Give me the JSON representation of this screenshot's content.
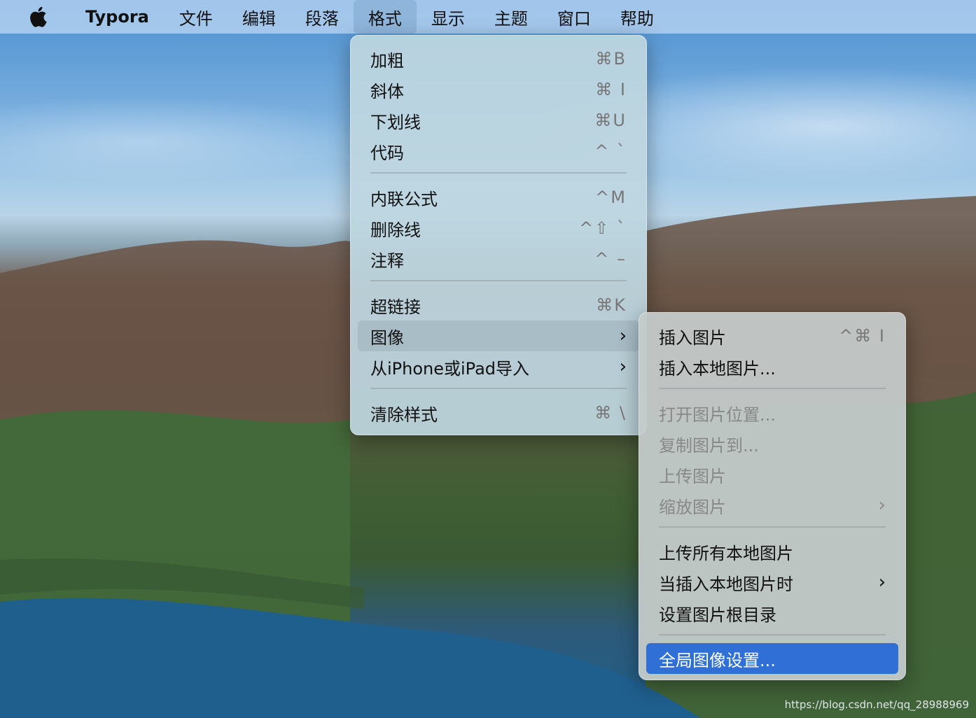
{
  "menubar": {
    "apple_icon": "apple-logo",
    "app_name": "Typora",
    "items": [
      "文件",
      "编辑",
      "段落",
      "格式",
      "显示",
      "主题",
      "窗口",
      "帮助"
    ],
    "active": "格式"
  },
  "format_menu": {
    "items": [
      {
        "label": "加粗",
        "shortcut": "⌘B"
      },
      {
        "label": "斜体",
        "shortcut": "⌘ I"
      },
      {
        "label": "下划线",
        "shortcut": "⌘U"
      },
      {
        "label": "代码",
        "shortcut": "^ `"
      },
      {
        "label": "内联公式",
        "shortcut": "^M"
      },
      {
        "label": "删除线",
        "shortcut": "^⇧ `"
      },
      {
        "label": "注释",
        "shortcut": "^ –"
      },
      {
        "label": "超链接",
        "shortcut": "⌘K"
      },
      {
        "label": "图像",
        "submenu": true
      },
      {
        "label": "从iPhone或iPad导入",
        "submenu": true
      },
      {
        "label": "清除样式",
        "shortcut": "⌘ \\"
      }
    ]
  },
  "image_submenu": {
    "items": [
      {
        "label": "插入图片",
        "shortcut": "^⌘ I"
      },
      {
        "label": "插入本地图片..."
      },
      {
        "label": "打开图片位置...",
        "disabled": true
      },
      {
        "label": "复制图片到...",
        "disabled": true
      },
      {
        "label": "上传图片",
        "disabled": true
      },
      {
        "label": "缩放图片",
        "disabled": true,
        "submenu": true
      },
      {
        "label": "上传所有本地图片"
      },
      {
        "label": "当插入本地图片时",
        "submenu": true
      },
      {
        "label": "设置图片根目录"
      },
      {
        "label": "全局图像设置..."
      }
    ]
  },
  "watermark": "https://blog.csdn.net/qq_28988969",
  "colors": {
    "selection": "#2f6fd6"
  }
}
